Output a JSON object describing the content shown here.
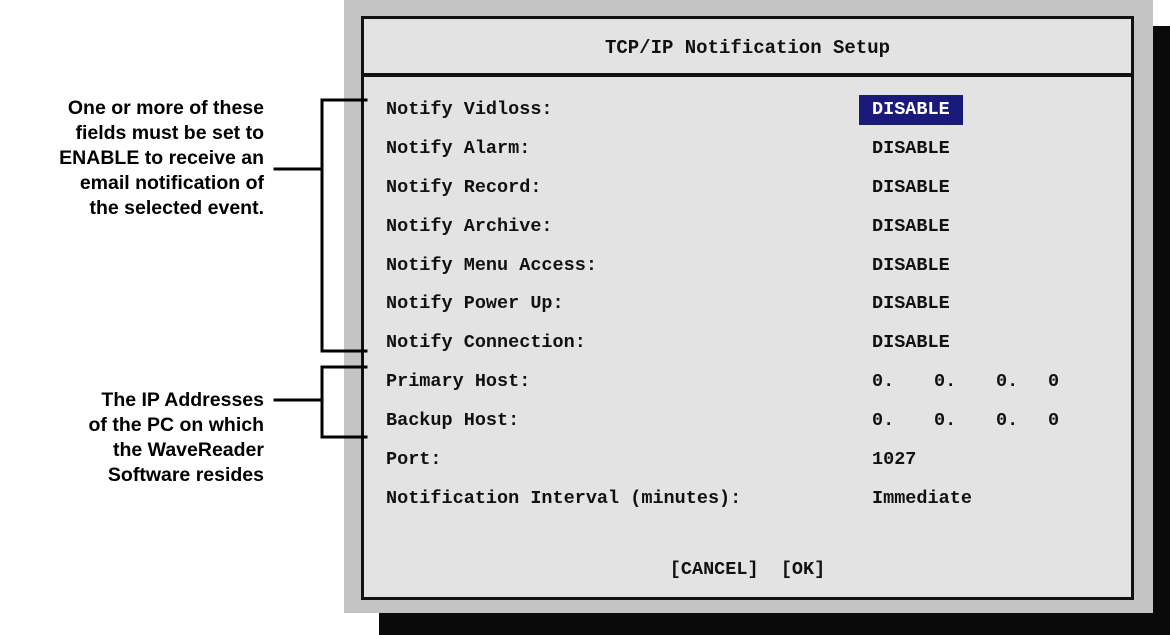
{
  "annotations": {
    "notify_note": [
      "One or more of these",
      "fields must be set to",
      "ENABLE to receive an",
      "email notification of",
      "the selected event."
    ],
    "host_note": [
      "The IP Addresses",
      "of the PC on which",
      "the WaveReader",
      "Software resides"
    ]
  },
  "dialog": {
    "title": "TCP/IP Notification Setup",
    "fields": [
      {
        "label": "Notify Vidloss:",
        "value": "DISABLE",
        "selected": true
      },
      {
        "label": "Notify Alarm:",
        "value": "DISABLE"
      },
      {
        "label": "Notify Record:",
        "value": "DISABLE"
      },
      {
        "label": "Notify Archive:",
        "value": "DISABLE"
      },
      {
        "label": "Notify Menu Access:",
        "value": "DISABLE"
      },
      {
        "label": "Notify Power Up:",
        "value": "DISABLE"
      },
      {
        "label": "Notify Connection:",
        "value": "DISABLE"
      }
    ],
    "primary_host": {
      "label": "Primary Host:",
      "octets": [
        "0.",
        "0.",
        "0.",
        "0"
      ]
    },
    "backup_host": {
      "label": "Backup Host:",
      "octets": [
        "0.",
        "0.",
        "0.",
        "0"
      ]
    },
    "port": {
      "label": "Port:",
      "value": "1027"
    },
    "interval": {
      "label": "Notification Interval (minutes):",
      "value": "Immediate"
    },
    "cancel_label": "[CANCEL]",
    "ok_label": "[OK]"
  },
  "colors": {
    "selected_bg": "#1a1a7a",
    "dialog_bg": "#e3e3e3",
    "frame": "#c4c4c4"
  }
}
